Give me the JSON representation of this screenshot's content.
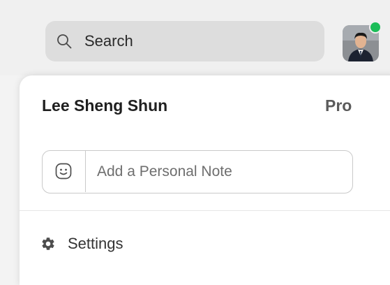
{
  "search": {
    "placeholder": "Search",
    "icon": "search-icon"
  },
  "user": {
    "name": "Lee Sheng Shun",
    "plan": "Pro",
    "status_color": "#1bbd58"
  },
  "note": {
    "placeholder": "Add a Personal Note",
    "icon": "smile-icon"
  },
  "menu": {
    "settings_label": "Settings",
    "settings_icon": "gear-icon"
  }
}
